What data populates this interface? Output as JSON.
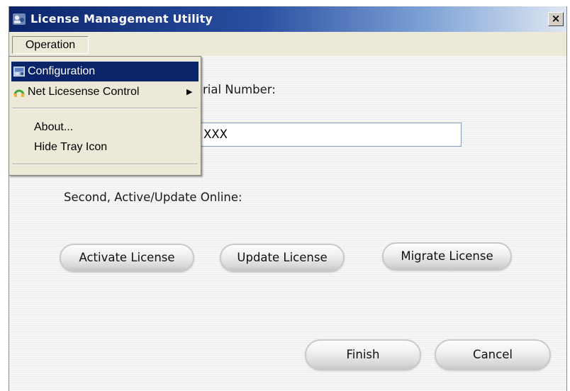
{
  "window": {
    "title": "License Management Utility",
    "close_glyph": "×",
    "title_icon": "app-icon"
  },
  "menubar": {
    "operation": "Operation"
  },
  "dropdown": {
    "items": [
      {
        "label": "Configuration",
        "icon": "configuration-icon",
        "selected": true
      },
      {
        "label": "Net Licesense Control",
        "icon": "net-license-icon",
        "submenu": true
      },
      {
        "label": "About..."
      },
      {
        "label": "Hide Tray Icon"
      }
    ],
    "submenu_arrow": "▶"
  },
  "main": {
    "serial_label_visible": "rial Number:",
    "serial_value_visible": "XXX",
    "second_label": "Second, Active/Update Online:",
    "buttons": {
      "activate": "Activate License",
      "update": "Update License",
      "migrate": "Migrate License",
      "finish": "Finish",
      "cancel": "Cancel"
    }
  },
  "colors": {
    "titlebar_start": "#0a246a",
    "titlebar_end": "#dfe7f3",
    "menu_selection": "#0a246a"
  }
}
